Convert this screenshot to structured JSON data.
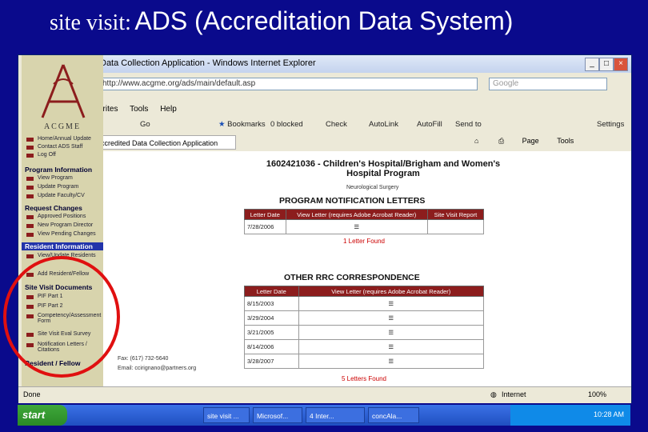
{
  "slide": {
    "title_prefix": "site visit:",
    "title_main": "ADS (Accreditation Data System)"
  },
  "browser": {
    "window_title": "Data Collection Application - Windows Internet Explorer",
    "address": "http://www.acgme.org/ads/main/default.asp",
    "search_placeholder": "Google",
    "menu": [
      "orites",
      "Tools",
      "Help"
    ],
    "toolbar": {
      "go": "Go",
      "bookmarks": "Bookmarks",
      "blocked": "0 blocked",
      "check": "Check",
      "autolink": "AutoLink",
      "autofill": "AutoFill",
      "sendto": "Send to",
      "settings": "Settings"
    },
    "tab_label": "ccredited Data Collection Application",
    "command": {
      "page": "Page",
      "tools": "Tools"
    },
    "status": {
      "left": "Done",
      "zone": "Internet",
      "zoom": "100%"
    }
  },
  "sidebar": {
    "brand": "ACGME",
    "top_links": [
      "Home/Annual Update",
      "Contact ADS Staff",
      "Log Off"
    ],
    "sections": [
      {
        "title": "Program Information",
        "links": [
          "View Program",
          "Update Program",
          "Update Faculty/CV"
        ]
      },
      {
        "title": "Request Changes",
        "links": [
          "Approved Positions",
          "New Program Director",
          "View Pending Changes"
        ]
      },
      {
        "title": "Resident Information",
        "links": [
          "View/Update Residents",
          "Add Resident/Fellow"
        ]
      },
      {
        "title": "Site Visit Documents",
        "links": [
          "PIF Part 1",
          "PIF Part 2",
          "Competency/Assessment Form",
          "Site Visit Eval Survey",
          "Notification Letters / Citations"
        ]
      },
      {
        "title": "Resident / Fellow",
        "links": []
      }
    ]
  },
  "main": {
    "program_title": "1602421036 - Children's Hospital/Brigham and Women's Hospital Program",
    "specialty": "Neurological Surgery",
    "notification": {
      "heading": "PROGRAM NOTIFICATION LETTERS",
      "columns": [
        "Letter Date",
        "View Letter (requires Adobe Acrobat Reader)",
        "Site Visit Report"
      ],
      "rows": [
        [
          "7/28/2006",
          "☰",
          ""
        ]
      ],
      "count_text": "1 Letter Found"
    },
    "rrc": {
      "heading": "OTHER RRC CORRESPONDENCE",
      "columns": [
        "Letter Date",
        "View Letter (requires Adobe Acrobat Reader)"
      ],
      "rows": [
        [
          "8/15/2003",
          "☰"
        ],
        [
          "3/29/2004",
          "☰"
        ],
        [
          "3/21/2005",
          "☰"
        ],
        [
          "8/14/2006",
          "☰"
        ],
        [
          "3/28/2007",
          "☰"
        ]
      ],
      "count_text": "5 Letters Found"
    },
    "contact": {
      "fax": "Fax: (617) 732-5640",
      "email": "Email: ccirignano@partners.org"
    }
  },
  "taskbar": {
    "start": "start",
    "tasks": [
      "site visit ...",
      "Microsof...",
      "4 Inter...",
      "concAla..."
    ],
    "clock": "10:28 AM"
  },
  "colors": {
    "slide_bg": "#0a0a8c",
    "table_header": "#8c1d1d",
    "sidebar_bg": "#d8d4ad",
    "annotation": "#e01010"
  }
}
